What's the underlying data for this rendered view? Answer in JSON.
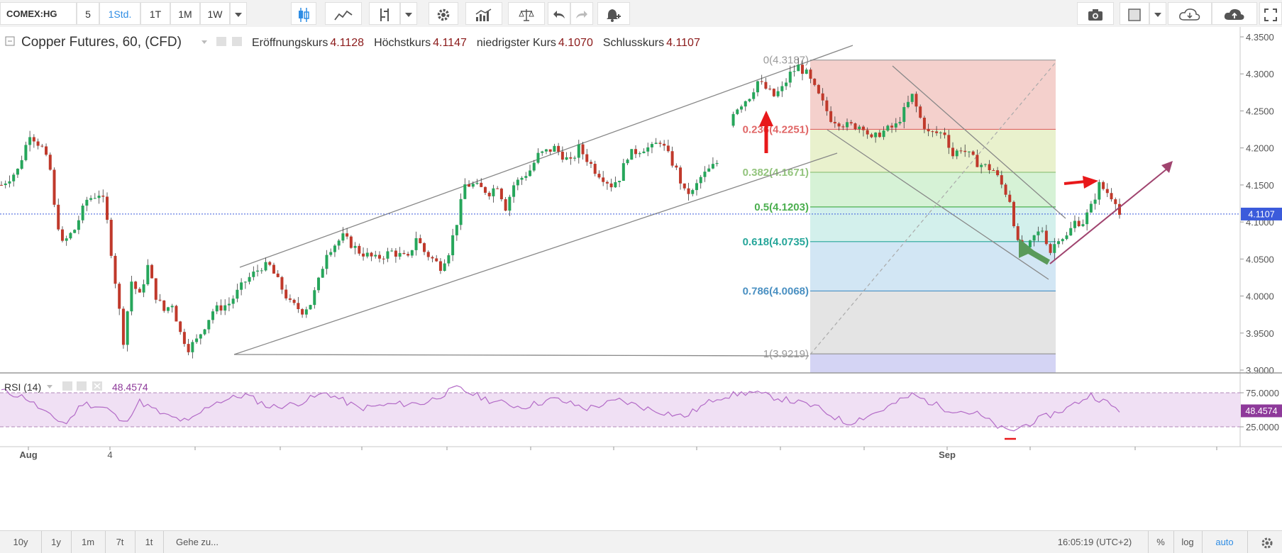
{
  "toolbar": {
    "symbol": "COMEX:HG",
    "intervals": [
      "5",
      "1Std.",
      "1T",
      "1M",
      "1W"
    ],
    "active_interval": "1Std."
  },
  "legend": {
    "title": "Copper Futures, 60, (CFD)",
    "open_label": "Eröffnungskurs",
    "open_value": "4.1128",
    "high_label": "Höchstkurs",
    "high_value": "4.1147",
    "low_label": "niedrigster Kurs",
    "low_value": "4.1070",
    "close_label": "Schlusskurs",
    "close_value": "4.1107"
  },
  "rsi_legend": {
    "label": "RSI (14)",
    "value": "48.4574"
  },
  "bottombar": {
    "ranges": [
      "10y",
      "1y",
      "1m",
      "7t",
      "1t"
    ],
    "goto": "Gehe zu...",
    "time": "16:05:19 (UTC+2)",
    "percent": "%",
    "log": "log",
    "auto": "auto"
  },
  "colors": {
    "up": "#26a65b",
    "down": "#c0392b",
    "price_line": "#3b5bdb",
    "rsi": "#b36bc7",
    "rsi_band": "#f0e0f4"
  },
  "chart_data": {
    "type": "candlestick",
    "symbol": "Copper Futures, 60, (CFD)",
    "ylim": [
      3.9,
      4.35
    ],
    "y_ticks": [
      "4.3500",
      "4.3000",
      "4.2500",
      "4.2000",
      "4.1500",
      "4.1000",
      "4.0500",
      "4.0000",
      "3.9500",
      "3.9000"
    ],
    "x_labels": [
      "Aug",
      "4",
      "Sep"
    ],
    "last_price": "4.1107",
    "ohlc": {
      "open": 4.1128,
      "high": 4.1147,
      "low": 4.107,
      "close": 4.1107
    },
    "price_path": [
      [
        0,
        4.15
      ],
      [
        2,
        4.17
      ],
      [
        3.5,
        4.22
      ],
      [
        5,
        4.2
      ],
      [
        6,
        4.17
      ],
      [
        6.5,
        4.12
      ],
      [
        7.5,
        4.07
      ],
      [
        9,
        4.09
      ],
      [
        10.5,
        4.13
      ],
      [
        12.3,
        4.14
      ],
      [
        13,
        4.1
      ],
      [
        14,
        4.02
      ],
      [
        15,
        3.94
      ],
      [
        16,
        4.02
      ],
      [
        17,
        4.0
      ],
      [
        18,
        4.04
      ],
      [
        19,
        4.0
      ],
      [
        20,
        3.98
      ],
      [
        21,
        3.99
      ],
      [
        22,
        3.95
      ],
      [
        23,
        3.93
      ],
      [
        24,
        3.94
      ],
      [
        26,
        3.98
      ],
      [
        28,
        3.99
      ],
      [
        30,
        4.02
      ],
      [
        32,
        4.04
      ],
      [
        33,
        4.04
      ],
      [
        34,
        4.02
      ],
      [
        35.5,
        3.99
      ],
      [
        37,
        3.98
      ],
      [
        38,
        3.99
      ],
      [
        39,
        4.02
      ],
      [
        40,
        4.06
      ],
      [
        42,
        4.08
      ],
      [
        44,
        4.06
      ],
      [
        46,
        4.05
      ],
      [
        48,
        4.06
      ],
      [
        50,
        4.05
      ],
      [
        51,
        4.08
      ],
      [
        52,
        4.06
      ],
      [
        54,
        4.04
      ],
      [
        55,
        4.06
      ],
      [
        56,
        4.1
      ],
      [
        57,
        4.15
      ],
      [
        58,
        4.15
      ],
      [
        60,
        4.14
      ],
      [
        61,
        4.15
      ],
      [
        62,
        4.12
      ],
      [
        63,
        4.15
      ],
      [
        65,
        4.17
      ],
      [
        66,
        4.19
      ],
      [
        68,
        4.2
      ],
      [
        70,
        4.18
      ],
      [
        71,
        4.2
      ],
      [
        73,
        4.17
      ],
      [
        74,
        4.16
      ],
      [
        75,
        4.15
      ],
      [
        76,
        4.16
      ],
      [
        77,
        4.19
      ],
      [
        79,
        4.2
      ],
      [
        80,
        4.2
      ],
      [
        81,
        4.21
      ],
      [
        82,
        4.19
      ],
      [
        83,
        4.17
      ],
      [
        84,
        4.14
      ],
      [
        85,
        4.14
      ],
      [
        86,
        4.16
      ],
      [
        88,
        4.18
      ],
      [
        89,
        4.21
      ],
      [
        90,
        4.25
      ],
      [
        92,
        4.27
      ],
      [
        93,
        4.29
      ],
      [
        95,
        4.27
      ],
      [
        96,
        4.28
      ],
      [
        97,
        4.3
      ],
      [
        98,
        4.31
      ],
      [
        99,
        4.3
      ],
      [
        100,
        4.28
      ],
      [
        102,
        4.24
      ],
      [
        104,
        4.23
      ],
      [
        106,
        4.23
      ],
      [
        107,
        4.21
      ],
      [
        108,
        4.22
      ],
      [
        110,
        4.23
      ],
      [
        111,
        4.25
      ],
      [
        112,
        4.27
      ],
      [
        113,
        4.24
      ],
      [
        114,
        4.22
      ],
      [
        116,
        4.22
      ],
      [
        117,
        4.19
      ],
      [
        118,
        4.2
      ],
      [
        120,
        4.18
      ],
      [
        122,
        4.17
      ],
      [
        123,
        4.15
      ],
      [
        124,
        4.13
      ],
      [
        125,
        4.07
      ],
      [
        126,
        4.06
      ],
      [
        127,
        4.08
      ],
      [
        128,
        4.09
      ],
      [
        129,
        4.06
      ],
      [
        130,
        4.08
      ],
      [
        131,
        4.08
      ],
      [
        132,
        4.1
      ],
      [
        133,
        4.1
      ],
      [
        134,
        4.12
      ],
      [
        135,
        4.15
      ],
      [
        136,
        4.14
      ],
      [
        137,
        4.13
      ],
      [
        137.5,
        4.11
      ]
    ],
    "fibonacci": {
      "levels": [
        {
          "label": "0(4.3187)",
          "value": 4.3187,
          "color": "#999999"
        },
        {
          "label": "0.236(4.2251)",
          "value": 4.2251,
          "color": "#e06666"
        },
        {
          "label": "0.382(4.1671)",
          "value": 4.1671,
          "color": "#93c47d"
        },
        {
          "label": "0.5(4.1203)",
          "value": 4.1203,
          "color": "#4caf50"
        },
        {
          "label": "0.618(4.0735)",
          "value": 4.0735,
          "color": "#26a69a"
        },
        {
          "label": "0.786(4.0068)",
          "value": 4.0068,
          "color": "#4a90c2"
        },
        {
          "label": "1(3.9219)",
          "value": 3.9219,
          "color": "#999999"
        }
      ]
    },
    "rsi": {
      "label": "RSI (14)",
      "value": "48.4574",
      "upper": 75,
      "lower": 25,
      "y_ticks": [
        "75.0000",
        "25.0000"
      ],
      "path": [
        [
          0,
          78
        ],
        [
          3,
          68
        ],
        [
          6,
          40
        ],
        [
          8,
          30
        ],
        [
          10,
          60
        ],
        [
          13,
          52
        ],
        [
          15,
          30
        ],
        [
          17,
          62
        ],
        [
          20,
          42
        ],
        [
          23,
          32
        ],
        [
          26,
          60
        ],
        [
          30,
          72
        ],
        [
          33,
          54
        ],
        [
          36,
          58
        ],
        [
          40,
          75
        ],
        [
          44,
          52
        ],
        [
          48,
          58
        ],
        [
          52,
          60
        ],
        [
          56,
          82
        ],
        [
          60,
          64
        ],
        [
          64,
          54
        ],
        [
          68,
          66
        ],
        [
          72,
          52
        ],
        [
          76,
          64
        ],
        [
          80,
          50
        ],
        [
          84,
          40
        ],
        [
          88,
          68
        ],
        [
          92,
          76
        ],
        [
          96,
          66
        ],
        [
          100,
          55
        ],
        [
          104,
          30
        ],
        [
          108,
          48
        ],
        [
          112,
          72
        ],
        [
          116,
          52
        ],
        [
          120,
          44
        ],
        [
          123,
          22
        ],
        [
          124,
          18
        ],
        [
          126,
          28
        ],
        [
          128,
          38
        ],
        [
          131,
          52
        ],
        [
          134,
          72
        ],
        [
          136,
          60
        ],
        [
          137.5,
          48
        ]
      ]
    }
  }
}
